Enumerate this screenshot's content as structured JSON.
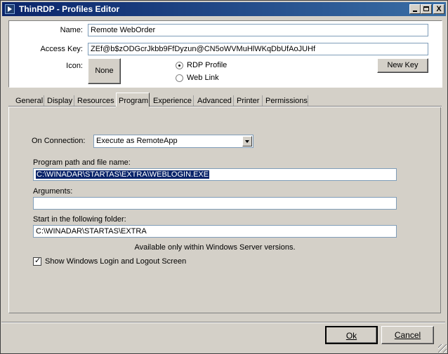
{
  "window": {
    "title": "ThinRDP - Profiles Editor",
    "min_glyph": "_",
    "max_glyph": "□",
    "close_glyph": "X"
  },
  "profile": {
    "name_label": "Name:",
    "name_value": "Remote WebOrder",
    "access_key_label": "Access Key:",
    "access_key_value": "ZEf@b$zODGcrJkbb9FfDyzun@CN5oWVMuHlWKqDbUfAoJUHf",
    "icon_label": "Icon:",
    "icon_button": "None",
    "new_key_button": "New Key",
    "radio_rdp": "RDP Profile",
    "radio_web": "Web Link",
    "selected_type": "RDP Profile"
  },
  "tabs": [
    {
      "label": "General"
    },
    {
      "label": "Display"
    },
    {
      "label": "Resources"
    },
    {
      "label": "Program"
    },
    {
      "label": "Experience"
    },
    {
      "label": "Advanced"
    },
    {
      "label": "Printer"
    },
    {
      "label": "Permissions"
    }
  ],
  "active_tab": "Program",
  "program": {
    "on_connection_label": "On Connection:",
    "on_connection_value": "Execute as RemoteApp",
    "path_label": "Program path and file name:",
    "path_value": "C:\\WINADAR\\STARTAS\\EXTRA\\WEBLOGIN.EXE",
    "arguments_label": "Arguments:",
    "arguments_value": "",
    "start_folder_label": "Start in the following folder:",
    "start_folder_value": "C:\\WINADAR\\STARTAS\\EXTRA",
    "note": "Available only within Windows Server versions.",
    "show_login_label": "Show Windows Login and Logout Screen",
    "show_login_checked": true
  },
  "footer": {
    "ok_label": "Ok",
    "cancel_label": "Cancel"
  },
  "colors": {
    "title_start": "#0a246a",
    "title_end": "#3a6ea5",
    "face": "#d4d0c8",
    "selection": "#0a246a"
  }
}
